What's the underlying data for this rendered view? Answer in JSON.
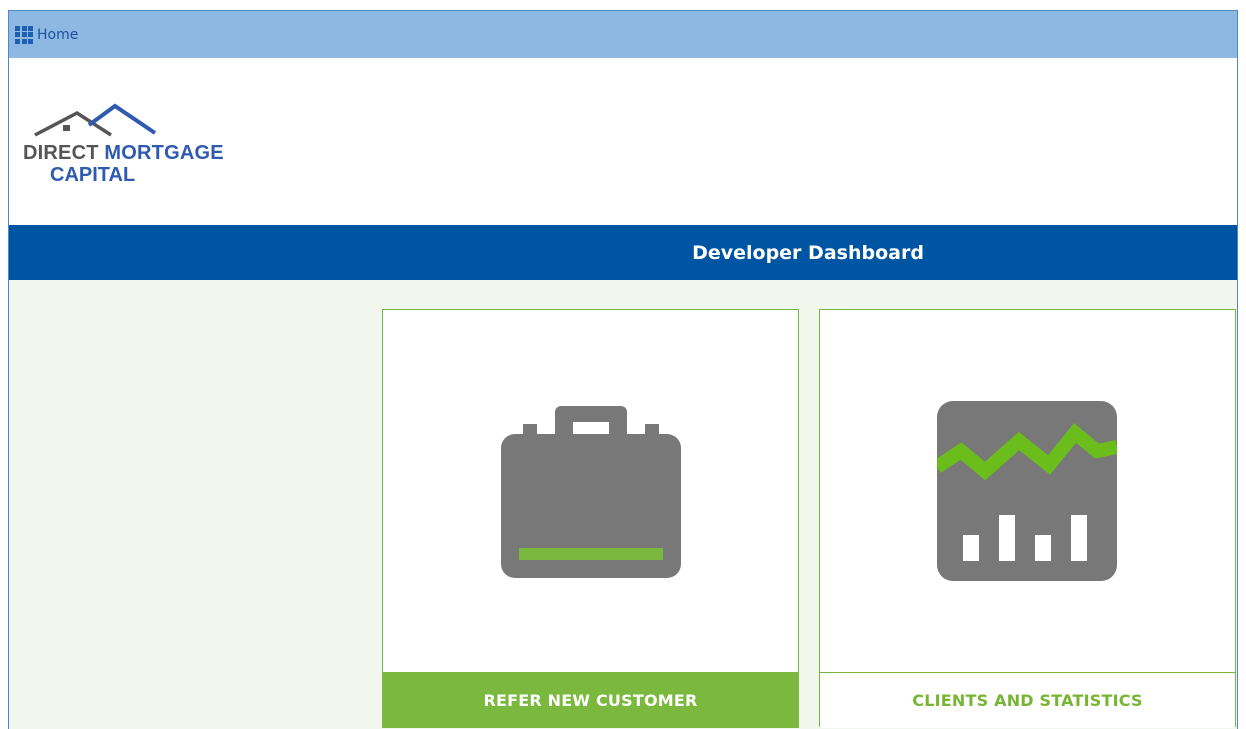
{
  "topbar": {
    "home_label": "Home",
    "icon": "apps-grid-icon"
  },
  "logo": {
    "word_direct": "DIRECT",
    "word_mortgage": "MORTGAGE",
    "word_capital": "CAPITAL",
    "icon": "house-roof-icon"
  },
  "header": {
    "title": "Developer Dashboard"
  },
  "cards": [
    {
      "label": "REFER NEW CUSTOMER",
      "icon": "briefcase-icon"
    },
    {
      "label": "CLIENTS AND STATISTICS",
      "icon": "statistics-chart-icon"
    }
  ],
  "colors": {
    "topbar": "#8db8e1",
    "title_bar": "#0055a2",
    "accent_green": "#7ab83e",
    "icon_gray": "#787878",
    "content_bg": "#f2f7ee"
  }
}
